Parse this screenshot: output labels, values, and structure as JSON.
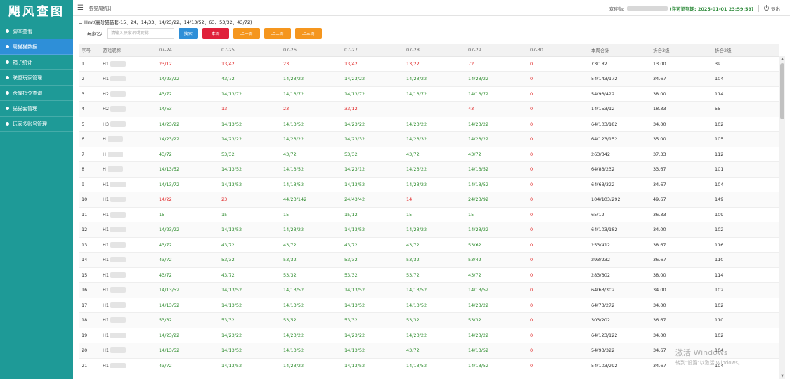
{
  "sidebar": {
    "logo": "飓风查图",
    "items": [
      {
        "label": "脚本查看",
        "active": false
      },
      {
        "label": "周猫猫数据",
        "active": true
      },
      {
        "label": "箱子统计",
        "active": false
      },
      {
        "label": "联盟玩家管理",
        "active": false
      },
      {
        "label": "仓库指令查询",
        "active": false
      },
      {
        "label": "猫猫套管理",
        "active": false
      },
      {
        "label": "玩家多账号管理",
        "active": false
      }
    ]
  },
  "topbar": {
    "breadcrumb": "猫猫周统计",
    "welcome": "欢迎你:",
    "license": "(许可证到期: 2025-01-01 23:59:59)",
    "logout": "退出"
  },
  "notice": "Hmt(高阶猫猫套-15、24、14/33、14/23/22、14/13/52、63、53/32、43/72)",
  "search": {
    "label": "玩家名:",
    "placeholder": "请输入玩家名或昵称",
    "buttons": {
      "search": "搜索",
      "this_week": "本周",
      "last_week": "上一周",
      "two_weeks": "上二周",
      "three_weeks": "上三周"
    }
  },
  "table": {
    "headers": [
      "序号",
      "游戏昵称",
      "07-24",
      "07-25",
      "07-26",
      "07-27",
      "07-28",
      "07-29",
      "07-30",
      "本周合计",
      "折合3级",
      "折合2级"
    ],
    "rows": [
      {
        "no": "1",
        "name": "H1",
        "d": [
          "23/12",
          "13/42",
          "23",
          "13/42",
          "13/22",
          "72",
          "0"
        ],
        "c": [
          "r",
          "r",
          "r",
          "r",
          "r",
          "r",
          "r"
        ],
        "total": "73/182",
        "l3": "13.00",
        "l2": "39"
      },
      {
        "no": "2",
        "name": "H1",
        "d": [
          "14/23/22",
          "43/72",
          "14/23/22",
          "14/23/22",
          "14/23/22",
          "14/23/22",
          "0"
        ],
        "c": [
          "g",
          "g",
          "g",
          "g",
          "g",
          "g",
          "r"
        ],
        "total": "54/143/172",
        "l3": "34.67",
        "l2": "104"
      },
      {
        "no": "3",
        "name": "H2",
        "d": [
          "43/72",
          "14/13/72",
          "14/13/72",
          "14/13/72",
          "14/13/72",
          "14/13/72",
          "0"
        ],
        "c": [
          "g",
          "g",
          "g",
          "g",
          "g",
          "g",
          "r"
        ],
        "total": "54/93/422",
        "l3": "38.00",
        "l2": "114"
      },
      {
        "no": "4",
        "name": "H2",
        "d": [
          "14/53",
          "13",
          "23",
          "33/12",
          "",
          "43",
          "0"
        ],
        "c": [
          "g",
          "r",
          "r",
          "r",
          "r",
          "r",
          "r"
        ],
        "total": "14/153/12",
        "l3": "18.33",
        "l2": "55"
      },
      {
        "no": "5",
        "name": "H3",
        "d": [
          "14/23/22",
          "14/13/52",
          "14/13/52",
          "14/23/22",
          "14/23/22",
          "14/23/22",
          "0"
        ],
        "c": [
          "g",
          "g",
          "g",
          "g",
          "g",
          "g",
          "r"
        ],
        "total": "64/103/182",
        "l3": "34.00",
        "l2": "102"
      },
      {
        "no": "6",
        "name": "H",
        "d": [
          "14/23/22",
          "14/23/22",
          "14/23/22",
          "14/23/32",
          "14/23/32",
          "14/23/22",
          "0"
        ],
        "c": [
          "g",
          "g",
          "g",
          "g",
          "g",
          "g",
          "r"
        ],
        "total": "64/123/152",
        "l3": "35.00",
        "l2": "105"
      },
      {
        "no": "7",
        "name": "H",
        "d": [
          "43/72",
          "53/32",
          "43/72",
          "53/32",
          "43/72",
          "43/72",
          "0"
        ],
        "c": [
          "g",
          "g",
          "g",
          "g",
          "g",
          "g",
          "r"
        ],
        "total": "263/342",
        "l3": "37.33",
        "l2": "112"
      },
      {
        "no": "8",
        "name": "H",
        "d": [
          "14/13/52",
          "14/13/52",
          "14/13/52",
          "14/23/12",
          "14/23/22",
          "14/13/52",
          "0"
        ],
        "c": [
          "g",
          "g",
          "g",
          "g",
          "g",
          "g",
          "r"
        ],
        "total": "64/83/232",
        "l3": "33.67",
        "l2": "101"
      },
      {
        "no": "9",
        "name": "H1",
        "d": [
          "14/13/72",
          "14/13/52",
          "14/13/52",
          "14/13/52",
          "14/23/22",
          "14/13/52",
          "0"
        ],
        "c": [
          "g",
          "g",
          "g",
          "g",
          "g",
          "g",
          "r"
        ],
        "total": "64/63/322",
        "l3": "34.67",
        "l2": "104"
      },
      {
        "no": "10",
        "name": "H1",
        "d": [
          "14/22",
          "23",
          "44/23/142",
          "24/43/42",
          "14",
          "24/23/92",
          "0"
        ],
        "c": [
          "r",
          "r",
          "g",
          "g",
          "r",
          "g",
          "r"
        ],
        "total": "104/103/292",
        "l3": "49.67",
        "l2": "149"
      },
      {
        "no": "11",
        "name": "H1",
        "d": [
          "15",
          "15",
          "15",
          "15/12",
          "15",
          "15",
          "0"
        ],
        "c": [
          "g",
          "g",
          "g",
          "g",
          "g",
          "g",
          "r"
        ],
        "total": "65/12",
        "l3": "36.33",
        "l2": "109"
      },
      {
        "no": "12",
        "name": "H1",
        "d": [
          "14/23/22",
          "14/13/52",
          "14/23/22",
          "14/13/52",
          "14/23/22",
          "14/23/22",
          "0"
        ],
        "c": [
          "g",
          "g",
          "g",
          "g",
          "g",
          "g",
          "r"
        ],
        "total": "64/103/182",
        "l3": "34.00",
        "l2": "102"
      },
      {
        "no": "13",
        "name": "H1",
        "d": [
          "43/72",
          "43/72",
          "43/72",
          "43/72",
          "43/72",
          "53/62",
          "0"
        ],
        "c": [
          "g",
          "g",
          "g",
          "g",
          "g",
          "g",
          "r"
        ],
        "total": "253/412",
        "l3": "38.67",
        "l2": "116"
      },
      {
        "no": "14",
        "name": "H1",
        "d": [
          "43/72",
          "53/32",
          "53/32",
          "53/32",
          "53/32",
          "53/42",
          "0"
        ],
        "c": [
          "g",
          "g",
          "g",
          "g",
          "g",
          "g",
          "r"
        ],
        "total": "293/232",
        "l3": "36.67",
        "l2": "110"
      },
      {
        "no": "15",
        "name": "H1",
        "d": [
          "43/72",
          "43/72",
          "53/32",
          "53/32",
          "53/72",
          "43/72",
          "0"
        ],
        "c": [
          "g",
          "g",
          "g",
          "g",
          "g",
          "g",
          "r"
        ],
        "total": "283/302",
        "l3": "38.00",
        "l2": "114"
      },
      {
        "no": "16",
        "name": "H1",
        "d": [
          "14/13/52",
          "14/13/52",
          "14/13/52",
          "14/13/52",
          "14/13/52",
          "14/13/52",
          "0"
        ],
        "c": [
          "g",
          "g",
          "g",
          "g",
          "g",
          "g",
          "r"
        ],
        "total": "64/63/302",
        "l3": "34.00",
        "l2": "102"
      },
      {
        "no": "17",
        "name": "H1",
        "d": [
          "14/13/52",
          "14/13/52",
          "14/13/52",
          "14/13/52",
          "14/13/52",
          "14/23/22",
          "0"
        ],
        "c": [
          "g",
          "g",
          "g",
          "g",
          "g",
          "g",
          "r"
        ],
        "total": "64/73/272",
        "l3": "34.00",
        "l2": "102"
      },
      {
        "no": "18",
        "name": "H1",
        "d": [
          "53/32",
          "53/32",
          "53/52",
          "53/32",
          "53/32",
          "53/32",
          "0"
        ],
        "c": [
          "g",
          "g",
          "g",
          "g",
          "g",
          "g",
          "r"
        ],
        "total": "303/202",
        "l3": "36.67",
        "l2": "110"
      },
      {
        "no": "19",
        "name": "H1",
        "d": [
          "14/23/22",
          "14/23/22",
          "14/23/22",
          "14/23/22",
          "14/23/22",
          "14/23/22",
          "0"
        ],
        "c": [
          "g",
          "g",
          "g",
          "g",
          "g",
          "g",
          "r"
        ],
        "total": "64/123/122",
        "l3": "34.00",
        "l2": "102"
      },
      {
        "no": "20",
        "name": "H1",
        "d": [
          "14/13/52",
          "14/13/52",
          "14/13/52",
          "14/13/52",
          "43/72",
          "14/13/52",
          "0"
        ],
        "c": [
          "g",
          "g",
          "g",
          "g",
          "g",
          "g",
          "r"
        ],
        "total": "54/93/322",
        "l3": "34.67",
        "l2": "104"
      },
      {
        "no": "21",
        "name": "H1",
        "d": [
          "43/72",
          "14/13/52",
          "14/23/22",
          "14/13/52",
          "14/13/52",
          "14/13/52",
          "0"
        ],
        "c": [
          "g",
          "g",
          "g",
          "g",
          "g",
          "g",
          "r"
        ],
        "total": "54/103/292",
        "l3": "34.67",
        "l2": "104"
      }
    ]
  },
  "watermark": {
    "line1": "激活 Windows",
    "line2": "转到\"设置\"以激活 Windows。"
  },
  "colors": {
    "sidebar": "#1e9a97",
    "active": "#2e8fd8",
    "green": "#2a8a2a",
    "red": "#e02424",
    "orange": "#f5961e",
    "search_btn": "#2e8fd8",
    "this_week_btn": "#e0203a"
  }
}
